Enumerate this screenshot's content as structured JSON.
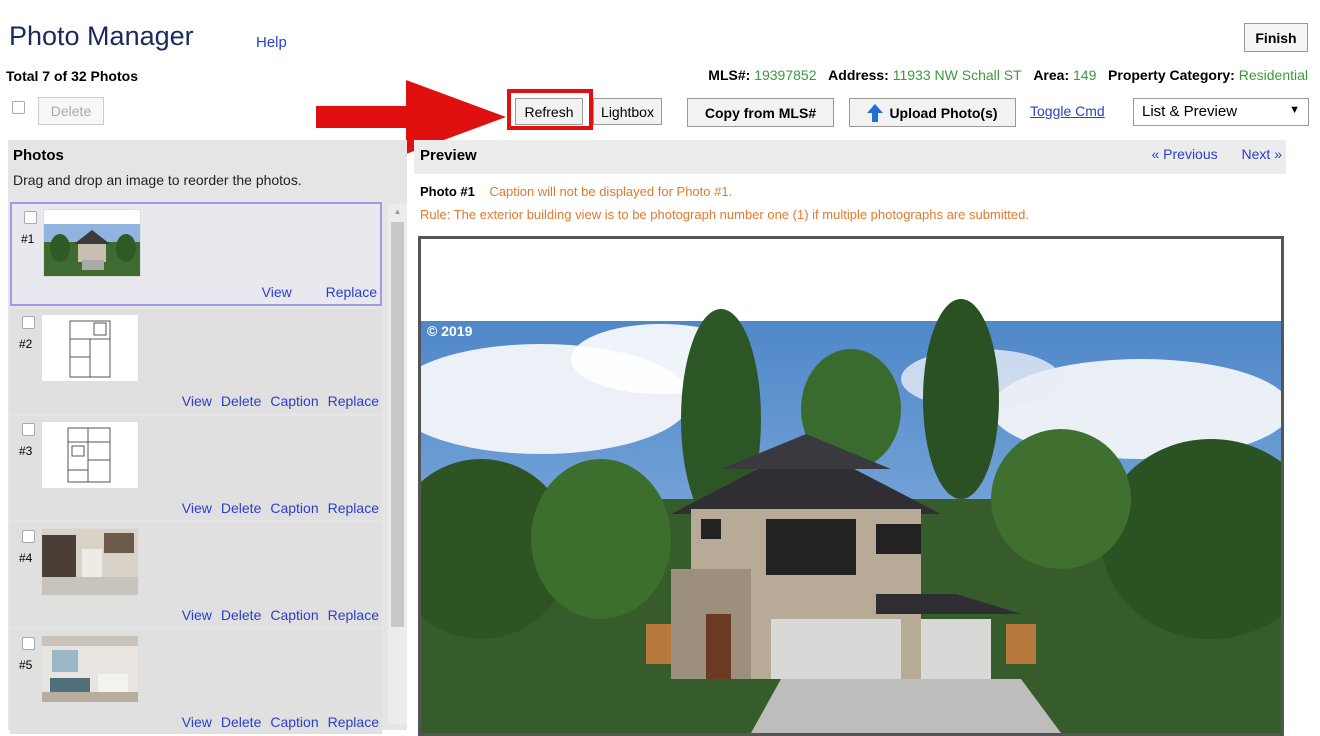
{
  "header": {
    "title": "Photo Manager",
    "help": "Help",
    "finish": "Finish",
    "total": "Total 7 of 32 Photos"
  },
  "info": {
    "mls_label": "MLS#:",
    "mls_value": "19397852",
    "address_label": "Address:",
    "address_value": "11933 NW Schall ST",
    "area_label": "Area:",
    "area_value": "149",
    "category_label": "Property Category:",
    "category_value": "Residential"
  },
  "toolbar": {
    "delete": "Delete",
    "refresh": "Refresh",
    "lightbox": "Lightbox",
    "copy": "Copy from MLS#",
    "upload": "Upload Photo(s)",
    "toggle": "Toggle Cmd",
    "view_select": "List & Preview"
  },
  "photos_panel": {
    "title": "Photos",
    "desc": "Drag and drop an image to reorder the photos.",
    "items": [
      {
        "num": "#1",
        "view": "View",
        "replace": "Replace"
      },
      {
        "num": "#2",
        "view": "View",
        "delete": "Delete",
        "caption": "Caption",
        "replace": "Replace"
      },
      {
        "num": "#3",
        "view": "View",
        "delete": "Delete",
        "caption": "Caption",
        "replace": "Replace"
      },
      {
        "num": "#4",
        "view": "View",
        "delete": "Delete",
        "caption": "Caption",
        "replace": "Replace"
      },
      {
        "num": "#5",
        "view": "View",
        "delete": "Delete",
        "caption": "Caption",
        "replace": "Replace"
      }
    ]
  },
  "preview": {
    "title": "Preview",
    "previous": "« Previous",
    "next": "Next »",
    "photo_label": "Photo #1",
    "caption_note": "Caption will not be displayed for Photo #1.",
    "rule": "Rule: The exterior building view is to be photograph number one (1) if multiple photographs are submitted.",
    "copyright": "© 2019"
  },
  "colors": {
    "link": "#2b3fc9",
    "green": "#3a9a3a",
    "orange": "#e07a30",
    "highlight": "#e01010"
  }
}
